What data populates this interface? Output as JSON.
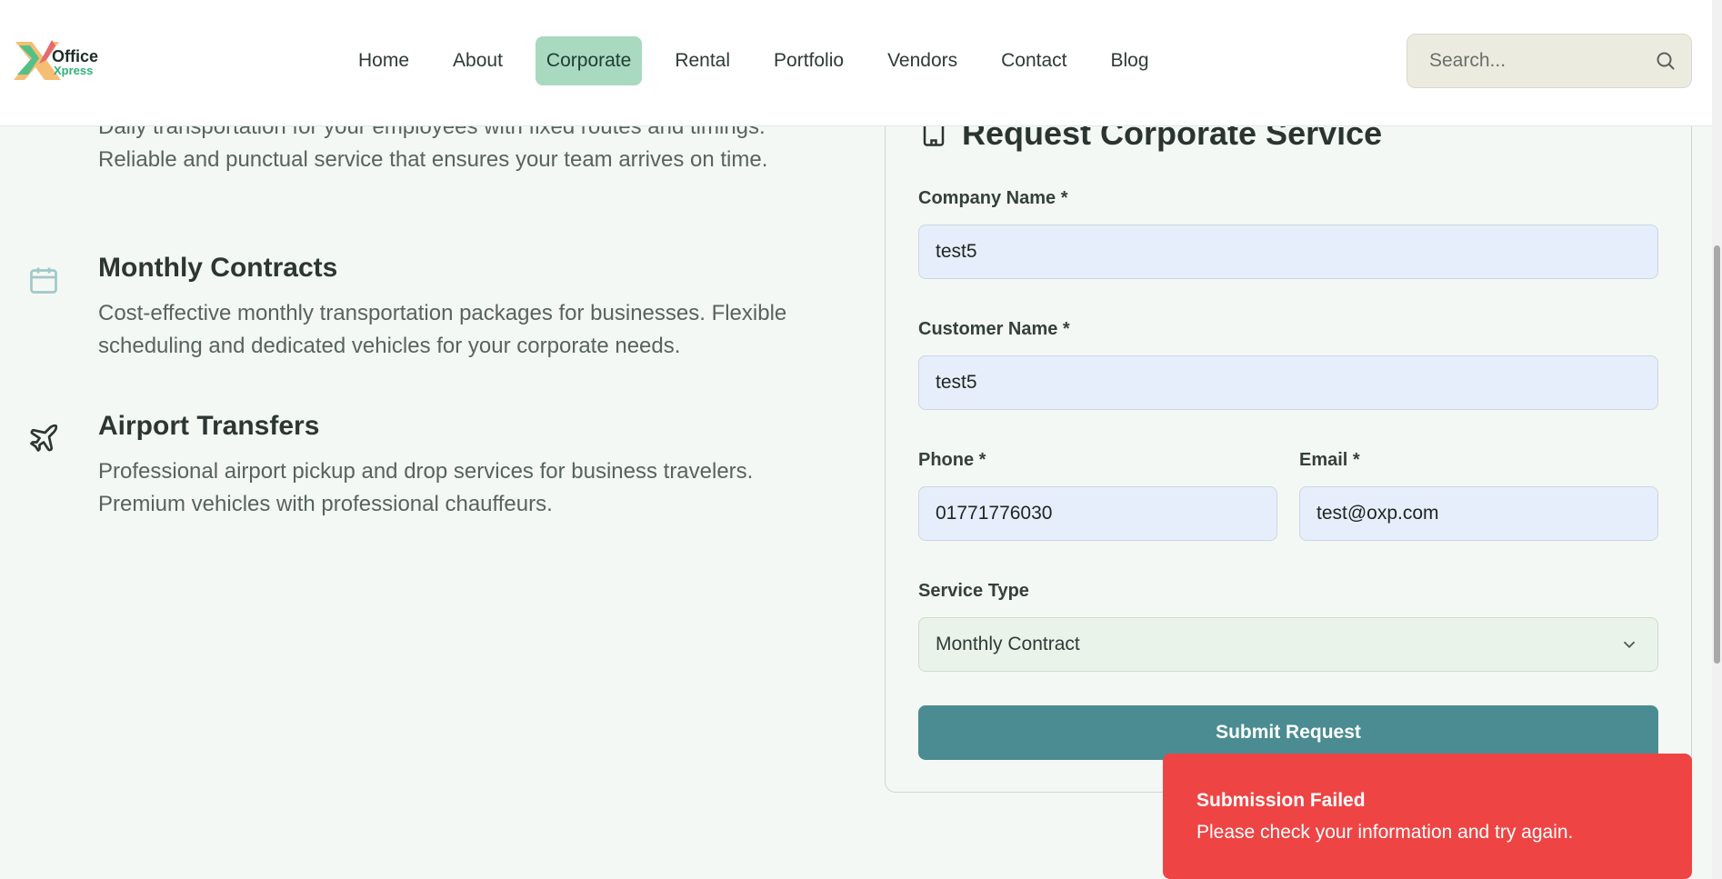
{
  "header": {
    "logo_text_1": "Office",
    "logo_text_2": "Xpress",
    "nav": [
      "Home",
      "About",
      "Corporate",
      "Rental",
      "Portfolio",
      "Vendors",
      "Contact",
      "Blog"
    ],
    "active_nav": "Corporate",
    "search_placeholder": "Search..."
  },
  "services": [
    {
      "title": "",
      "desc_line1": "Daily transportation for your employees with fixed routes and timings.",
      "desc_line2": "Reliable and punctual service that ensures your team arrives on time."
    },
    {
      "title": "Monthly Contracts",
      "desc_line1": "Cost-effective monthly transportation packages for businesses. Flexible",
      "desc_line2": "scheduling and dedicated vehicles for your corporate needs.",
      "icon": "calendar-icon"
    },
    {
      "title": "Airport Transfers",
      "desc_line1": "Professional airport pickup and drop services for business travelers.",
      "desc_line2": "Premium vehicles with professional chauffeurs.",
      "icon": "airplane-icon"
    }
  ],
  "form": {
    "title": "Request Corporate Service",
    "company_label": "Company Name *",
    "company_value": "test5",
    "customer_label": "Customer Name *",
    "customer_value": "test5",
    "phone_label": "Phone *",
    "phone_value": "01771776030",
    "email_label": "Email *",
    "email_value": "test@oxp.com",
    "service_label": "Service Type",
    "service_value": "Monthly Contract",
    "submit_label": "Submit Request"
  },
  "toast": {
    "title": "Submission Failed",
    "message": "Please check your information and try again."
  },
  "colors": {
    "accent": "#4a8c92",
    "active_nav": "#a9d9be",
    "toast": "#ef4444"
  }
}
